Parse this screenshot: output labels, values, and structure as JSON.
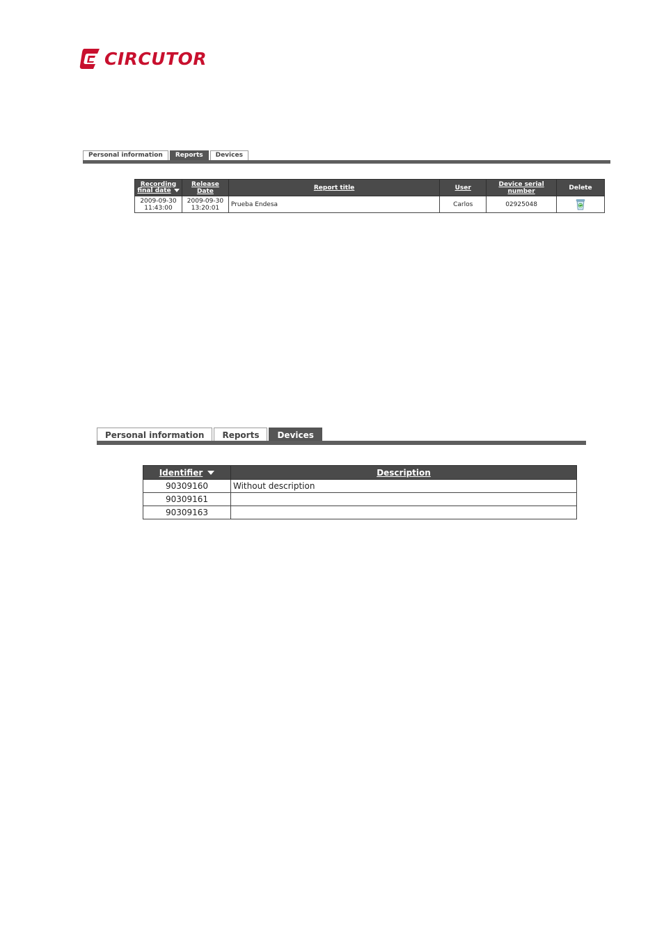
{
  "brand": {
    "name": "CIRCUTOR",
    "color": "#c8102e"
  },
  "reports_panel": {
    "tabs": [
      {
        "label": "Personal information",
        "active": false
      },
      {
        "label": "Reports",
        "active": true
      },
      {
        "label": "Devices",
        "active": false
      }
    ],
    "columns": {
      "recording_final_date_1": "Recording",
      "recording_final_date_2": "final date",
      "release_date": "Release Date",
      "report_title": "Report title",
      "user": "User",
      "device_serial": "Device serial number",
      "delete": "Delete"
    },
    "rows": [
      {
        "recording_date": "2009-09-30",
        "recording_time": "11:43:00",
        "release_date": "2009-09-30",
        "release_time": "13:20:01",
        "title": "Prueba Endesa",
        "user": "Carlos",
        "serial": "02925048",
        "delete_icon": "recycle-bin-icon"
      }
    ]
  },
  "devices_panel": {
    "tabs": [
      {
        "label": "Personal information",
        "active": false
      },
      {
        "label": "Reports",
        "active": false
      },
      {
        "label": "Devices",
        "active": true
      }
    ],
    "columns": {
      "identifier": "Identifier",
      "description": "Description"
    },
    "rows": [
      {
        "id": "90309160",
        "description": "Without description"
      },
      {
        "id": "90309161",
        "description": ""
      },
      {
        "id": "90309163",
        "description": ""
      }
    ]
  }
}
